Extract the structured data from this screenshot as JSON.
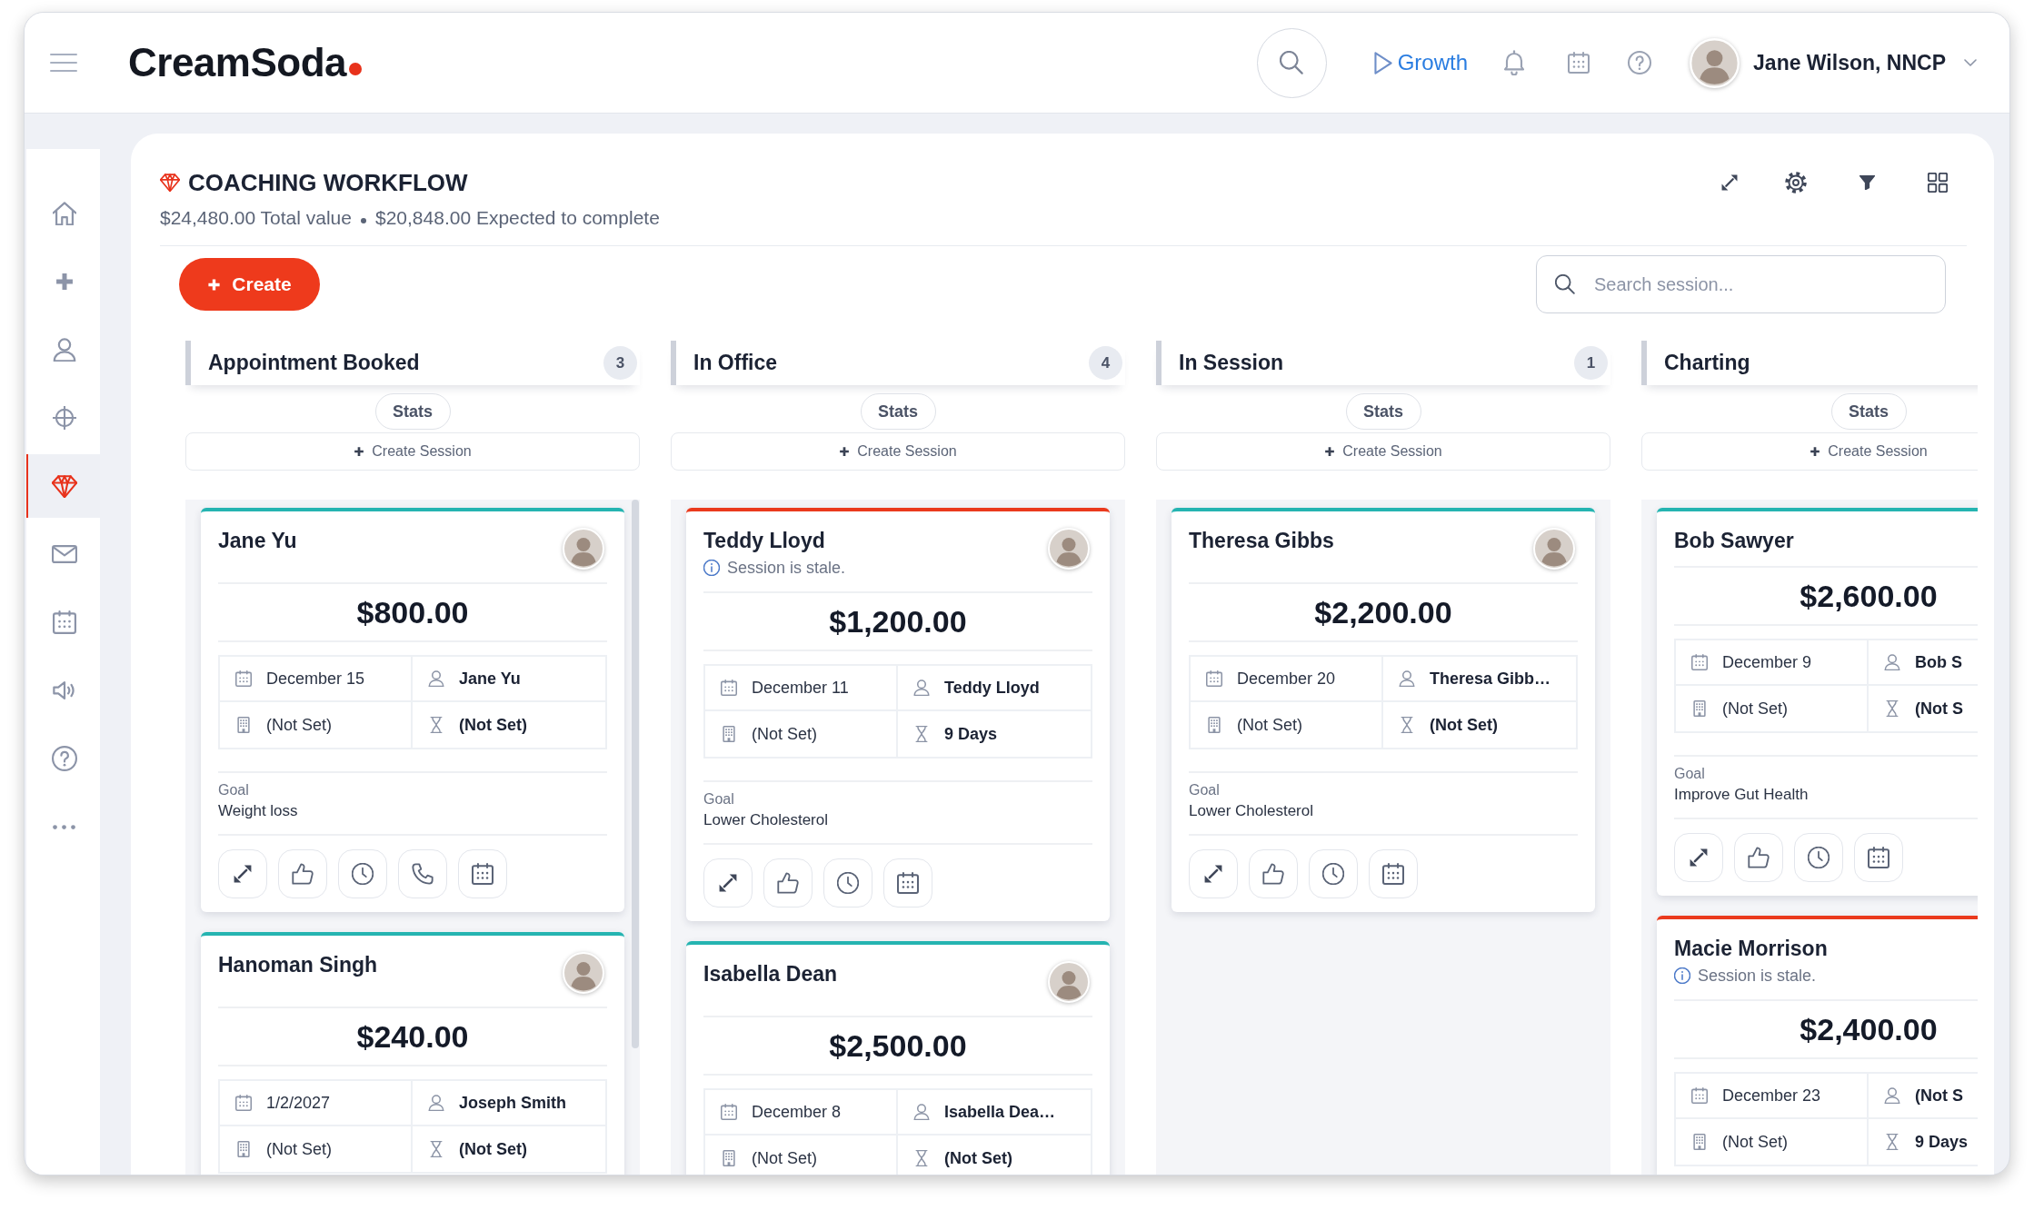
{
  "header": {
    "logo": "CreamSoda",
    "growth_link": "Growth",
    "user_name": "Jane Wilson, NNCP"
  },
  "sidebar": {
    "items": [
      {
        "kind": "home",
        "selected": false
      },
      {
        "kind": "add",
        "selected": false
      },
      {
        "kind": "contacts",
        "selected": false
      },
      {
        "kind": "target",
        "selected": false
      },
      {
        "kind": "workflow",
        "selected": true
      },
      {
        "kind": "mail",
        "selected": false
      },
      {
        "kind": "calendar",
        "selected": false
      },
      {
        "kind": "announcements",
        "selected": false
      },
      {
        "kind": "help",
        "selected": false
      },
      {
        "kind": "more",
        "selected": false
      }
    ]
  },
  "workflow": {
    "title": "COACHING WORKFLOW",
    "total_value": "$24,480.00 Total value",
    "expected_value": "$20,848.00 Expected to complete",
    "create_button": "Create",
    "search": {
      "placeholder": "Search session..."
    }
  },
  "columns": [
    {
      "title": "Appointment Booked",
      "count": "3",
      "stats_button": "Stats",
      "create_session": "Create Session",
      "scrollable": true,
      "cards": [
        {
          "name": "Jane Yu",
          "stale": false,
          "avatar": true,
          "price": "$800.00",
          "date": "December 15",
          "contact": "Jane Yu",
          "location": "(Not Set)",
          "duration": "(Not Set)",
          "goal_label": "Goal",
          "goal": "Weight loss",
          "actions": [
            {
              "kind": "expand"
            },
            {
              "kind": "like"
            },
            {
              "kind": "history"
            },
            {
              "kind": "call"
            },
            {
              "kind": "schedule"
            }
          ]
        },
        {
          "name": "Hanoman Singh",
          "stale": false,
          "avatar": true,
          "price": "$240.00",
          "date": "1/2/2027",
          "contact": "Joseph Smith",
          "location": "(Not Set)",
          "duration": "(Not Set)"
        }
      ]
    },
    {
      "title": "In Office",
      "count": "4",
      "stats_button": "Stats",
      "create_session": "Create Session",
      "scrollable": false,
      "cards": [
        {
          "name": "Teddy Lloyd",
          "stale": true,
          "note": "Session is stale.",
          "avatar": true,
          "price": "$1,200.00",
          "date": "December 11",
          "contact": "Teddy Lloyd",
          "location": "(Not Set)",
          "duration": "9 Days",
          "goal_label": "Goal",
          "goal": "Lower Cholesterol",
          "actions": [
            {
              "kind": "expand"
            },
            {
              "kind": "like"
            },
            {
              "kind": "history"
            },
            {
              "kind": "schedule"
            }
          ]
        },
        {
          "name": "Isabella Dean",
          "stale": false,
          "avatar": true,
          "price": "$2,500.00",
          "date": "December 8",
          "contact": "Isabella Dea…",
          "location": "(Not Set)",
          "duration": "(Not Set)"
        }
      ]
    },
    {
      "title": "In Session",
      "count": "1",
      "stats_button": "Stats",
      "create_session": "Create Session",
      "scrollable": false,
      "cards": [
        {
          "name": "Theresa Gibbs",
          "stale": false,
          "avatar": true,
          "price": "$2,200.00",
          "date": "December 20",
          "contact": "Theresa Gibb…",
          "location": "(Not Set)",
          "duration": "(Not Set)",
          "goal_label": "Goal",
          "goal": "Lower Cholesterol",
          "actions": [
            {
              "kind": "expand"
            },
            {
              "kind": "like"
            },
            {
              "kind": "history"
            },
            {
              "kind": "schedule"
            }
          ]
        }
      ]
    },
    {
      "title": "Charting",
      "stats_button": "Stats",
      "create_session": "Create Session",
      "scrollable": false,
      "cards": [
        {
          "name": "Bob Sawyer",
          "stale": false,
          "avatar": false,
          "price": "$2,600.00",
          "date": "December 9",
          "contact": "Bob S",
          "location": "(Not Set)",
          "duration": "(Not S",
          "goal_label": "Goal",
          "goal": "Improve Gut Health",
          "actions": [
            {
              "kind": "expand"
            },
            {
              "kind": "like"
            },
            {
              "kind": "history"
            },
            {
              "kind": "schedule"
            }
          ]
        },
        {
          "name": "Macie Morrison",
          "stale": true,
          "note": "Session is stale.",
          "avatar": false,
          "price": "$2,400.00",
          "date": "December 23",
          "contact": "(Not S",
          "location": "(Not Set)",
          "duration": "9 Days"
        }
      ]
    }
  ]
}
